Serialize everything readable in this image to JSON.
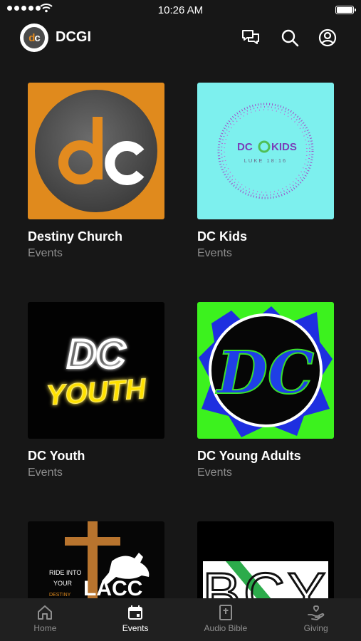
{
  "status_bar": {
    "time": "10:26 AM"
  },
  "header": {
    "title": "DCGI",
    "logo_letters": {
      "d": "d",
      "c": "c"
    }
  },
  "groups": [
    {
      "name": "Destiny Church",
      "subtitle": "Events",
      "image": "destiny-church-logo"
    },
    {
      "name": "DC Kids",
      "subtitle": "Events",
      "image": "dc-kids-logo",
      "logo_text": "DC",
      "logo_text2": "KIDS",
      "logo_tagline": "LUKE 18:16"
    },
    {
      "name": "DC Youth",
      "subtitle": "Events",
      "image": "dc-youth-neon-logo",
      "logo_text": "DC",
      "logo_text2": "YOUTH"
    },
    {
      "name": "DC Young Adults",
      "subtitle": "Events",
      "image": "dc-young-adults-logo",
      "logo_text": "DC"
    },
    {
      "name": "",
      "subtitle": "",
      "image": "lacc-ride-into-your-destiny-logo",
      "logo_lines": [
        "RIDE INTO",
        "YOUR",
        "DESTINY"
      ],
      "logo_word": "LACC"
    },
    {
      "name": "",
      "subtitle": "",
      "image": "bcy-logo",
      "logo_text": "BCY"
    }
  ],
  "tabs": [
    {
      "label": "Home",
      "icon": "home-icon"
    },
    {
      "label": "Events",
      "icon": "calendar-icon",
      "active": true
    },
    {
      "label": "Audio Bible",
      "icon": "bible-icon"
    },
    {
      "label": "Giving",
      "icon": "giving-hand-icon"
    }
  ],
  "colors": {
    "background": "#171717",
    "tab_bar": "#202020",
    "muted_text": "#8d8d8d",
    "brand_orange": "#e08a1d"
  }
}
